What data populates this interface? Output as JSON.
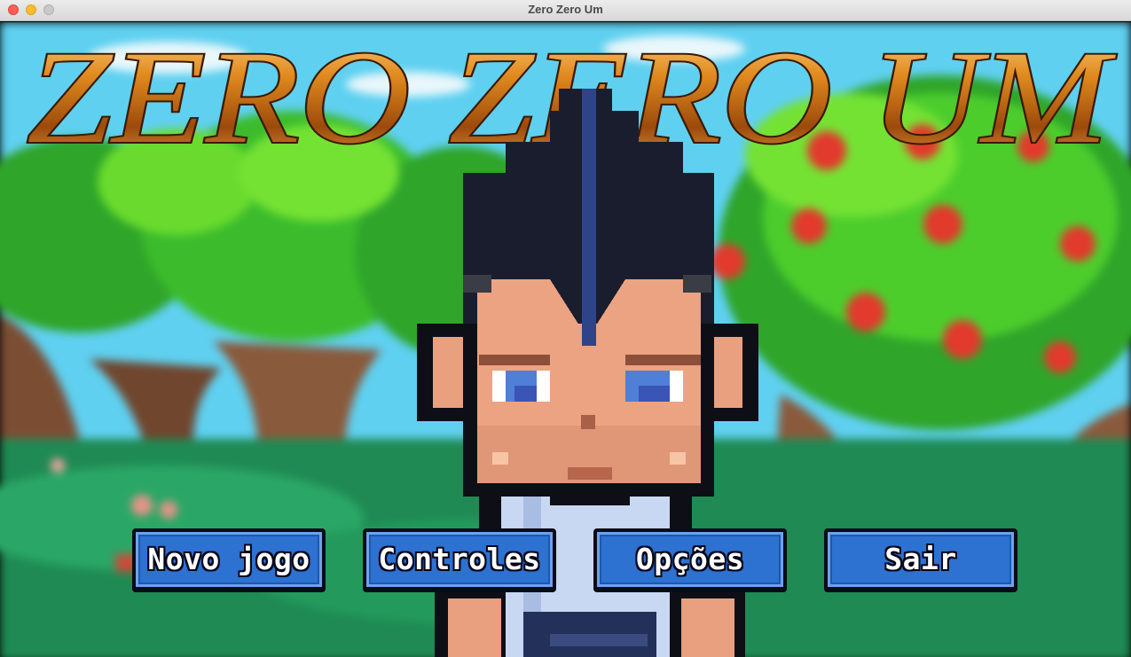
{
  "window": {
    "title": "Zero Zero Um"
  },
  "game": {
    "logo_text": "ZERO ZERO UM",
    "menu": [
      {
        "id": "novo-jogo",
        "label": "Novo jogo"
      },
      {
        "id": "controles",
        "label": "Controles"
      },
      {
        "id": "opcoes",
        "label": "Opções"
      },
      {
        "id": "sair",
        "label": "Sair"
      }
    ]
  },
  "colors": {
    "sky": "#5fd0f0",
    "foliage": "#3fbf2a",
    "trunk": "#8a5a3c",
    "ground": "#1f8a54",
    "button": "#2d71d1",
    "logo_gold": "#e08a1e"
  }
}
